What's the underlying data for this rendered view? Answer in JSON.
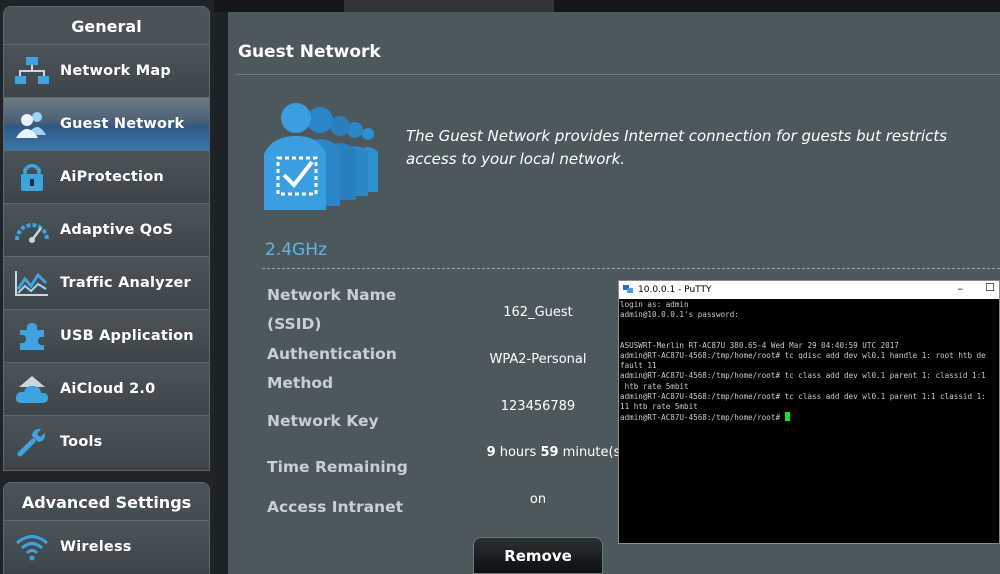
{
  "sidebar": {
    "general_header": "General",
    "items": [
      {
        "label": "Network Map",
        "icon": "network-map-icon",
        "active": false
      },
      {
        "label": "Guest Network",
        "icon": "guest-network-icon",
        "active": true
      },
      {
        "label": "AiProtection",
        "icon": "lock-icon",
        "active": false
      },
      {
        "label": "Adaptive QoS",
        "icon": "speedometer-icon",
        "active": false
      },
      {
        "label": "Traffic Analyzer",
        "icon": "traffic-chart-icon",
        "active": false
      },
      {
        "label": "USB Application",
        "icon": "puzzle-icon",
        "active": false
      },
      {
        "label": "AiCloud 2.0",
        "icon": "cloud-house-icon",
        "active": false
      },
      {
        "label": "Tools",
        "icon": "wrench-icon",
        "active": false
      }
    ],
    "advanced_header": "Advanced Settings",
    "advanced_items": [
      {
        "label": "Wireless",
        "icon": "wifi-icon"
      }
    ]
  },
  "main": {
    "title": "Guest Network",
    "intro": "The Guest Network provides Internet connection for guests but restricts access to your local network.",
    "band": "2.4GHz",
    "fields": {
      "network_name_label_1": "Network Name",
      "network_name_label_2": "(SSID)",
      "network_name_value": "162_Guest",
      "auth_label_1": "Authentication",
      "auth_label_2": "Method",
      "auth_value": "WPA2-Personal",
      "key_label": "Network Key",
      "key_value": "123456789",
      "time_label": "Time Remaining",
      "time_hours": "9",
      "time_hours_unit": " hours ",
      "time_minutes": "59",
      "time_minutes_unit": " minute(s)",
      "intranet_label": "Access Intranet",
      "intranet_value": "on"
    },
    "remove_label": "Remove"
  },
  "putty": {
    "title": "10.0.0.1 - PuTTY",
    "min": "–",
    "max": "☐",
    "lines": [
      "login as: admin",
      "admin@10.0.0.1's password:",
      "",
      "",
      "ASUSWRT-Merlin RT-AC87U 380.65-4 Wed Mar 29 04:40:59 UTC 2017",
      "admin@RT-AC87U-4568:/tmp/home/root# tc qdisc add dev wl0.1 handle 1: root htb de",
      "fault 11",
      "admin@RT-AC87U-4568:/tmp/home/root# tc class add dev wl0.1 parent 1: classid 1:1",
      " htb rate 5mbit",
      "admin@RT-AC87U-4568:/tmp/home/root# tc class add dev wl0.1 parent 1:1 classid 1:",
      "11 htb rate 5mbit"
    ],
    "prompt": "admin@RT-AC87U-4568:/tmp/home/root# "
  },
  "colors": {
    "accent_blue": "#5db6e8",
    "active_item": "#3d74ad",
    "cursor": "#1fe01f"
  }
}
